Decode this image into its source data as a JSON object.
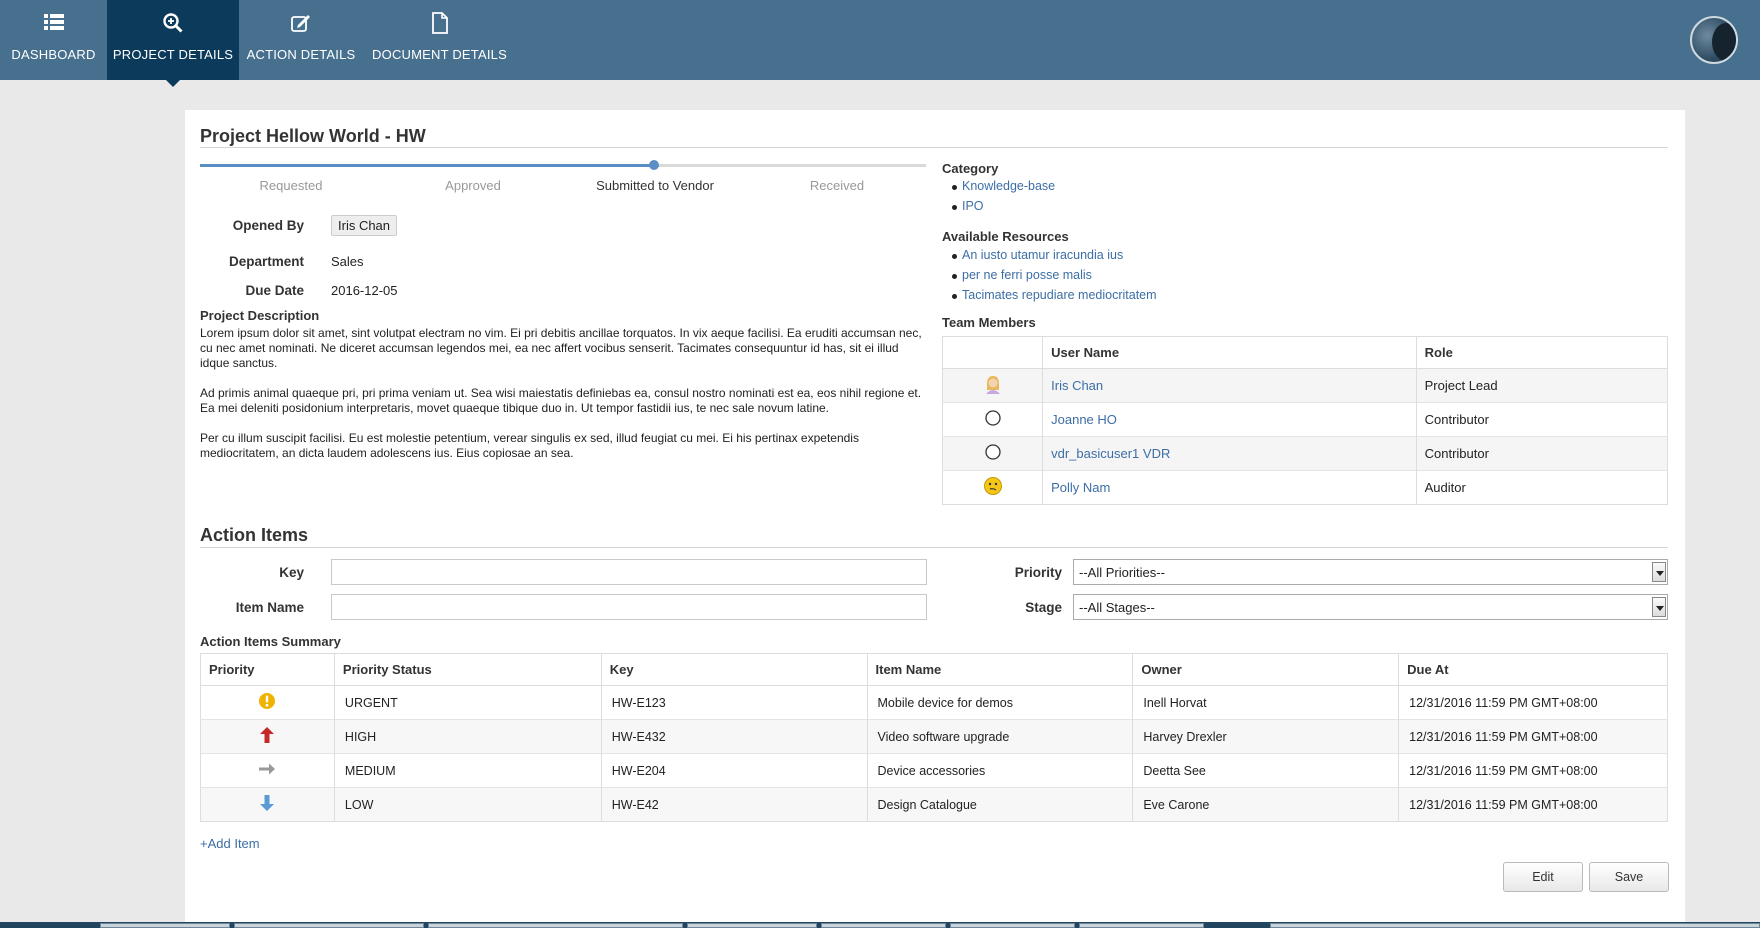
{
  "nav": {
    "items": [
      {
        "label": "DASHBOARD",
        "icon": "list-icon",
        "active": false
      },
      {
        "label": "PROJECT DETAILS",
        "icon": "search-icon",
        "active": true
      },
      {
        "label": "ACTION DETAILS",
        "icon": "edit-icon",
        "active": false
      },
      {
        "label": "DOCUMENT DETAILS",
        "icon": "document-icon",
        "active": false
      }
    ],
    "user_avatar": "user-avatar-icon"
  },
  "project": {
    "title": "Project Hellow World - HW",
    "progress": {
      "stages": [
        "Requested",
        "Approved",
        "Submitted to Vendor",
        "Received"
      ],
      "current_index": 2
    },
    "opened_by_label": "Opened By",
    "opened_by": "Iris Chan",
    "department_label": "Department",
    "department": "Sales",
    "due_date_label": "Due Date",
    "due_date": "2016-12-05",
    "description_heading": "Project Description",
    "description": [
      "Lorem ipsum dolor sit amet, sint volutpat electram no vim. Ei pri debitis ancillae torquatos. In vix aeque facilisi. Ea eruditi accumsan nec, cu nec amet nominati. Ne diceret accumsan legendos mei, ea nec affert vocibus senserit. Tacimates consequuntur id has, sit ei illud idque sanctus.",
      "Ad primis animal quaeque pri, pri prima veniam ut. Sea wisi maiestatis definiebas ea, consul nostro nominati est ea, eos nihil regione et. Ea mei deleniti posidonium interpretaris, movet quaeque tibique duo in. Ut tempor fastidii ius, te nec sale novum latine.",
      "Per cu illum suscipit facilisi. Eu est molestie petentium, verear singulis ex sed, illud feugiat cu mei. Ei his pertinax expetendis mediocritatem, an dicta laudem adolescens ius. Eius copiosae an sea."
    ]
  },
  "category": {
    "heading": "Category",
    "items": [
      "Knowledge-base",
      "IPO"
    ]
  },
  "resources": {
    "heading": "Available Resources",
    "items": [
      "An iusto utamur iracundia ius",
      "per ne ferri posse malis",
      "Tacimates repudiare mediocritatem"
    ]
  },
  "team": {
    "heading": "Team Members",
    "columns": [
      "",
      "User Name",
      "Role"
    ],
    "rows": [
      {
        "icon": "user-avatar-female-icon",
        "name": "Iris Chan",
        "role": "Project Lead"
      },
      {
        "icon": "empty-avatar-icon",
        "name": "Joanne HO",
        "role": "Contributor"
      },
      {
        "icon": "empty-avatar-icon",
        "name": "vdr_basicuser1 VDR",
        "role": "Contributor"
      },
      {
        "icon": "smiley-avatar-icon",
        "name": "Polly Nam",
        "role": "Auditor"
      }
    ]
  },
  "action_items": {
    "heading": "Action Items",
    "filters": {
      "key_label": "Key",
      "key_value": "",
      "item_name_label": "Item Name",
      "item_name_value": "",
      "priority_label": "Priority",
      "priority_selected": "--All Priorities--",
      "stage_label": "Stage",
      "stage_selected": "--All Stages--"
    },
    "summary_heading": "Action Items Summary",
    "columns": [
      "Priority",
      "Priority Status",
      "Key",
      "Item Name",
      "Owner",
      "Due At"
    ],
    "rows": [
      {
        "icon": "exclamation-circle-icon",
        "status": "URGENT",
        "key": "HW-E123",
        "item": "Mobile device for demos",
        "owner": "Inell Horvat",
        "due": "12/31/2016 11:59 PM GMT+08:00"
      },
      {
        "icon": "arrow-up-icon",
        "status": "HIGH",
        "key": "HW-E432",
        "item": "Video software upgrade",
        "owner": "Harvey Drexler",
        "due": "12/31/2016 11:59 PM GMT+08:00"
      },
      {
        "icon": "arrow-right-icon",
        "status": "MEDIUM",
        "key": "HW-E204",
        "item": "Device accessories",
        "owner": "Deetta See",
        "due": "12/31/2016 11:59 PM GMT+08:00"
      },
      {
        "icon": "arrow-down-icon",
        "status": "LOW",
        "key": "HW-E42",
        "item": "Design Catalogue",
        "owner": "Eve Carone",
        "due": "12/31/2016 11:59 PM GMT+08:00"
      }
    ],
    "add_item": "+Add Item",
    "edit_label": "Edit",
    "save_label": "Save"
  },
  "colors": {
    "nav_bg": "#47708f",
    "nav_active": "#0c3a5b",
    "link": "#3c6ea6",
    "progress": "#5b8ec4",
    "urgent": "#f0b400",
    "high": "#c62828",
    "medium": "#999999",
    "low": "#5b9bd5"
  }
}
